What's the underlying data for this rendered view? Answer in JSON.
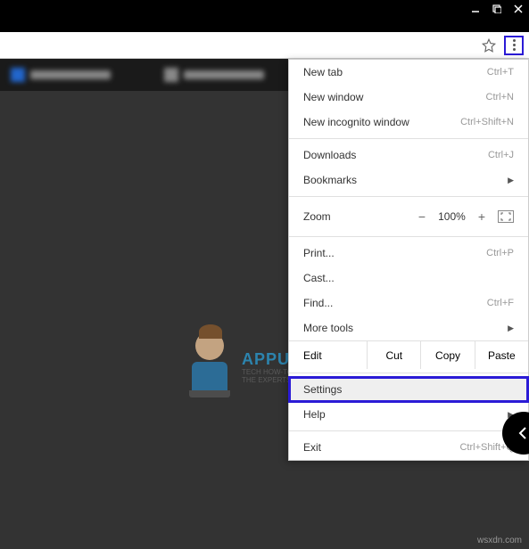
{
  "watermark": {
    "brand": "APPUALS",
    "tagline1": "TECH HOW-TO'S FROM",
    "tagline2": "THE EXPERTS"
  },
  "credit": "wsxdn.com",
  "menu": {
    "newTab": {
      "label": "New tab",
      "shortcut": "Ctrl+T"
    },
    "newWindow": {
      "label": "New window",
      "shortcut": "Ctrl+N"
    },
    "newIncognito": {
      "label": "New incognito window",
      "shortcut": "Ctrl+Shift+N"
    },
    "downloads": {
      "label": "Downloads",
      "shortcut": "Ctrl+J"
    },
    "bookmarks": {
      "label": "Bookmarks"
    },
    "zoom": {
      "label": "Zoom",
      "minus": "−",
      "value": "100%",
      "plus": "+"
    },
    "print": {
      "label": "Print...",
      "shortcut": "Ctrl+P"
    },
    "cast": {
      "label": "Cast..."
    },
    "find": {
      "label": "Find...",
      "shortcut": "Ctrl+F"
    },
    "moreTools": {
      "label": "More tools"
    },
    "edit": {
      "label": "Edit",
      "cut": "Cut",
      "copy": "Copy",
      "paste": "Paste"
    },
    "settings": {
      "label": "Settings"
    },
    "help": {
      "label": "Help"
    },
    "exit": {
      "label": "Exit",
      "shortcut": "Ctrl+Shift+Q"
    }
  }
}
